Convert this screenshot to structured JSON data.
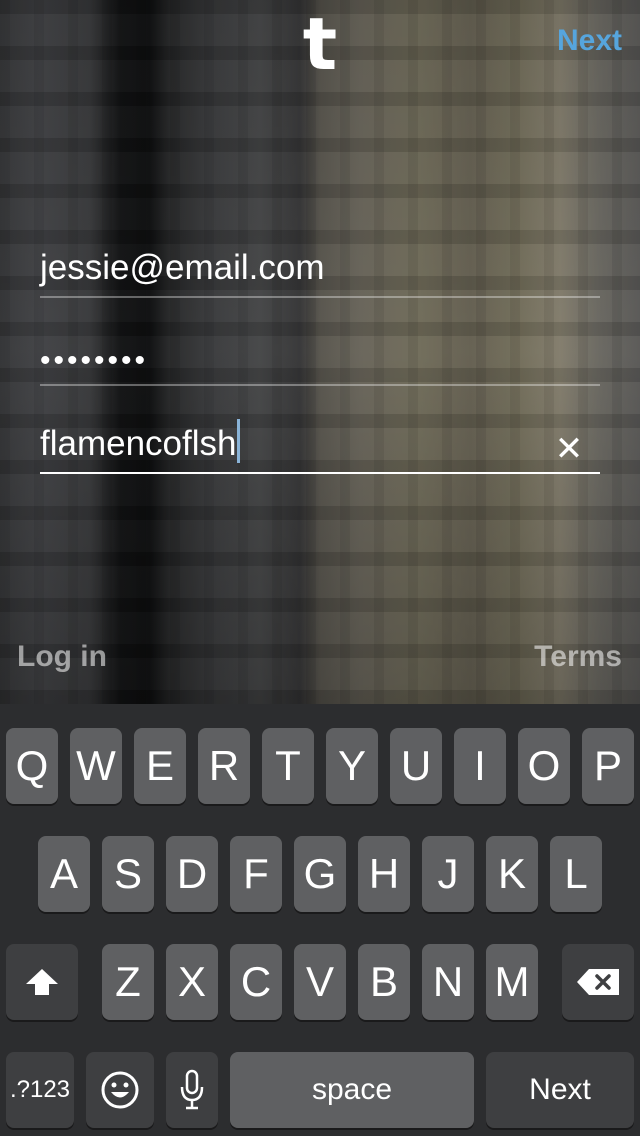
{
  "header": {
    "logo": "t",
    "next_label": "Next"
  },
  "form": {
    "email": "jessie@email.com",
    "password_masked": "••••••••",
    "username": "flamencoflsh",
    "clear_icon": "close-icon"
  },
  "footer": {
    "login_label": "Log in",
    "terms_label": "Terms"
  },
  "keyboard": {
    "row1": [
      "Q",
      "W",
      "E",
      "R",
      "T",
      "Y",
      "U",
      "I",
      "O",
      "P"
    ],
    "row2": [
      "A",
      "S",
      "D",
      "F",
      "G",
      "H",
      "J",
      "K",
      "L"
    ],
    "row3": [
      "Z",
      "X",
      "C",
      "V",
      "B",
      "N",
      "M"
    ],
    "numbers_label": ".?123",
    "space_label": "space",
    "return_label": "Next",
    "icons": [
      "shift-icon",
      "backspace-icon",
      "emoji-icon",
      "microphone-icon"
    ]
  },
  "colors": {
    "accent": "#56a5dd",
    "key": "#5f6062",
    "key_dark": "#3e3f41",
    "keyboard_bg": "#2c2d2f"
  }
}
